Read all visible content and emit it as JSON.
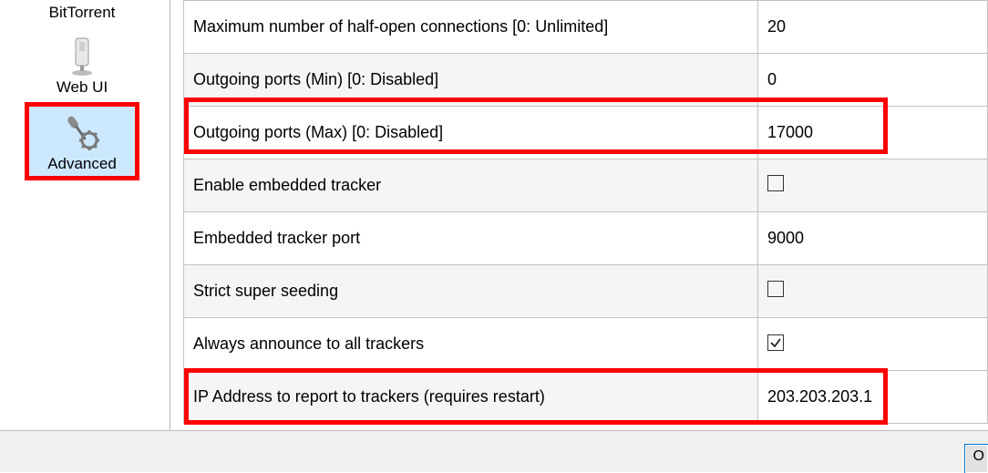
{
  "sidebar": {
    "items": [
      {
        "label": "BitTorrent",
        "selected": false,
        "highlight": false,
        "icon": "bittorrent-icon"
      },
      {
        "label": "Web UI",
        "selected": false,
        "highlight": false,
        "icon": "webui-icon"
      },
      {
        "label": "Advanced",
        "selected": true,
        "highlight": true,
        "icon": "advanced-icon"
      }
    ]
  },
  "settings": {
    "rows": [
      {
        "label": "Maximum number of half-open connections [0: Unlimited]",
        "type": "text",
        "value": "20",
        "highlight": false,
        "shade_value": false
      },
      {
        "label": "Outgoing ports (Min) [0: Disabled]",
        "type": "text",
        "value": "0",
        "highlight": false,
        "shade_value": false
      },
      {
        "label": "Outgoing ports (Max) [0: Disabled]",
        "type": "text",
        "value": "17000",
        "highlight": true,
        "shade_value": false
      },
      {
        "label": "Enable embedded tracker",
        "type": "checkbox",
        "value": "false",
        "highlight": false,
        "shade_value": true
      },
      {
        "label": "Embedded tracker port",
        "type": "text",
        "value": "9000",
        "highlight": false,
        "shade_value": false
      },
      {
        "label": "Strict super seeding",
        "type": "checkbox",
        "value": "false",
        "highlight": false,
        "shade_value": true
      },
      {
        "label": "Always announce to all trackers",
        "type": "checkbox",
        "value": "true",
        "highlight": false,
        "shade_value": false
      },
      {
        "label": "IP Address to report to trackers (requires restart)",
        "type": "text",
        "value": "203.203.203.1",
        "highlight": true,
        "shade_value": false
      }
    ]
  },
  "footer": {
    "button_partial": "O"
  }
}
